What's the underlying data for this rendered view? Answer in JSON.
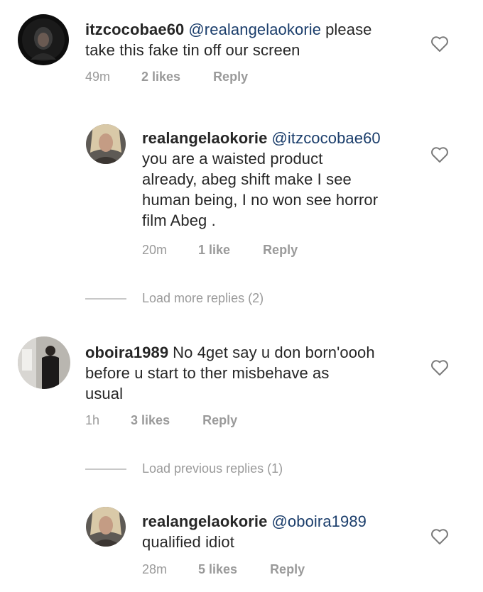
{
  "comments": [
    {
      "username": "itzcocobae60",
      "mention": "@realangelaokorie",
      "lines": [
        "please",
        "take this fake tin off our screen"
      ],
      "time": "49m",
      "likes": "2 likes",
      "reply": "Reply"
    },
    {
      "username": "realangelaokorie",
      "mention": "@itzcocobae60",
      "lines": [
        "you are a waisted product",
        "already, abeg shift make I see",
        "human being, I no won see horror",
        "film Abeg ."
      ],
      "time": "20m",
      "likes": "1 like",
      "reply": "Reply"
    },
    {
      "username": "oboira1989",
      "mention": "",
      "lines": [
        "No 4get say u don born'oooh",
        "before u start to ther misbehave  as",
        "usual"
      ],
      "time": "1h",
      "likes": "3 likes",
      "reply": "Reply"
    },
    {
      "username": "realangelaokorie",
      "mention": "@oboira1989",
      "lines": [
        "",
        "qualified idiot"
      ],
      "time": "28m",
      "likes": "5 likes",
      "reply": "Reply"
    }
  ],
  "load_more_replies": "Load more replies (2)",
  "load_previous_replies": "Load previous replies (1)",
  "colors": {
    "text": "#262626",
    "mention": "#1a3d6b",
    "meta": "#9a9a9a",
    "divider": "#c8c8c8"
  },
  "icons": {
    "like": "heart-outline-icon"
  }
}
